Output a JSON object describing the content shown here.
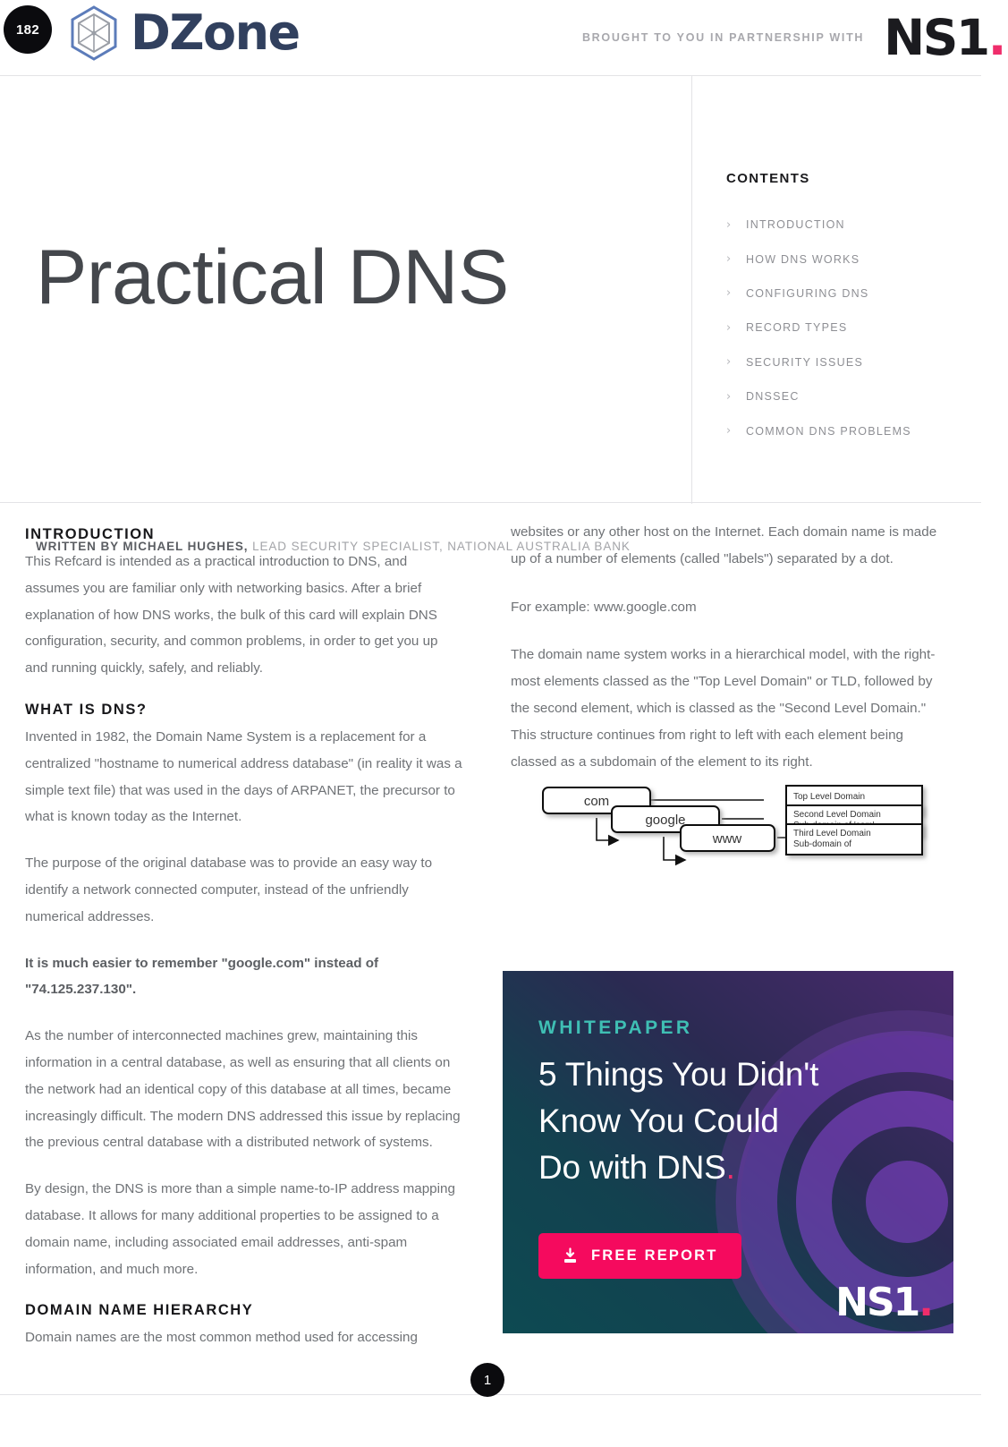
{
  "header": {
    "issue_number": "182",
    "brand": "DZone",
    "partnership_text": "BROUGHT TO YOU IN PARTNERSHIP WITH",
    "partner_logo": "NS1",
    "partner_logo_dot": "."
  },
  "cover": {
    "title": "Practical DNS",
    "byline_bold": "WRITTEN BY MICHAEL HUGHES,",
    "byline_rest": " LEAD SECURITY SPECIALIST, NATIONAL AUSTRALIA BANK"
  },
  "contents": {
    "heading": "CONTENTS",
    "items": [
      {
        "label": "INTRODUCTION"
      },
      {
        "label": "HOW DNS WORKS"
      },
      {
        "label": "CONFIGURING DNS"
      },
      {
        "label": "RECORD TYPES"
      },
      {
        "label": "SECURITY ISSUES"
      },
      {
        "label": "DNSSEC"
      },
      {
        "label": "COMMON DNS PROBLEMS"
      }
    ]
  },
  "left_column": {
    "intro_heading": "INTRODUCTION",
    "intro_body": "This Refcard is intended as a practical introduction to DNS, and assumes you are familiar only with networking basics. After a brief explanation of how DNS works, the bulk of this card will explain DNS configuration, security, and common problems, in order to get you up and running quickly, safely, and reliably.",
    "what_is_dns_heading": "WHAT IS DNS?",
    "what_is_dns_p1": "Invented in 1982, the Domain Name System is a replacement for a centralized \"hostname to numerical address database\" (in reality it was a simple text file) that was used in the days of ARPANET, the precursor to what is known today as the Internet.",
    "what_is_dns_p2": "The purpose of the original database was to provide an easy way to identify a network connected computer, instead of the unfriendly numerical addresses.",
    "callout": "It is much easier to remember \"google.com\" instead of \"74.125.237.130\".",
    "what_is_dns_p3": "As the number of interconnected machines grew, maintaining this information in a central database, as well as ensuring that all clients on the network had an identical copy of this database at all times, became increasingly difficult. The modern DNS addressed this issue by replacing the previous central database with a distributed network of systems.",
    "what_is_dns_p4": "By design, the DNS is more than a simple name-to-IP address mapping database. It allows for many additional properties to be assigned to a domain name, including associated email addresses, anti-spam information, and much more.",
    "hierarchy_heading": "DOMAIN NAME HIERARCHY",
    "hierarchy_body": "Domain names are the most common method used for accessing"
  },
  "right_column": {
    "p1": "websites or any other host on the Internet. Each domain name is made up of a number of elements (called \"labels\") separated by a dot.",
    "p2": "For example: www.google.com",
    "p3": "The domain name system works in a hierarchical model, with the right-most elements classed as the \"Top Level Domain\" or TLD, followed by the second element, which is classed as the \"Second Level Domain.\" This structure continues from right to left with each element being classed as a subdomain of the element to its right."
  },
  "diagram": {
    "nodes": [
      {
        "label": "com"
      },
      {
        "label": "google"
      },
      {
        "label": "www"
      }
    ],
    "annotations": [
      {
        "line1": "Top Level Domain",
        "line2": ""
      },
      {
        "line1": "Second Level Domain",
        "line2": "Sub-domain of 'com'"
      },
      {
        "line1": "Third Level Domain",
        "line2": "Sub-domain of"
      }
    ]
  },
  "ad": {
    "kicker": "WHITEPAPER",
    "title_line1": "5 Things You Didn't",
    "title_line2": "Know You Could",
    "title_line3": "Do with DNS",
    "title_dot": ".",
    "cta_label": "FREE REPORT",
    "cta_icon": "download-icon",
    "logo": "NS1",
    "logo_dot": ".",
    "accent_teal": "#3fbfb4",
    "accent_pink": "#f50a5e"
  },
  "footer": {
    "page_number": "1"
  }
}
